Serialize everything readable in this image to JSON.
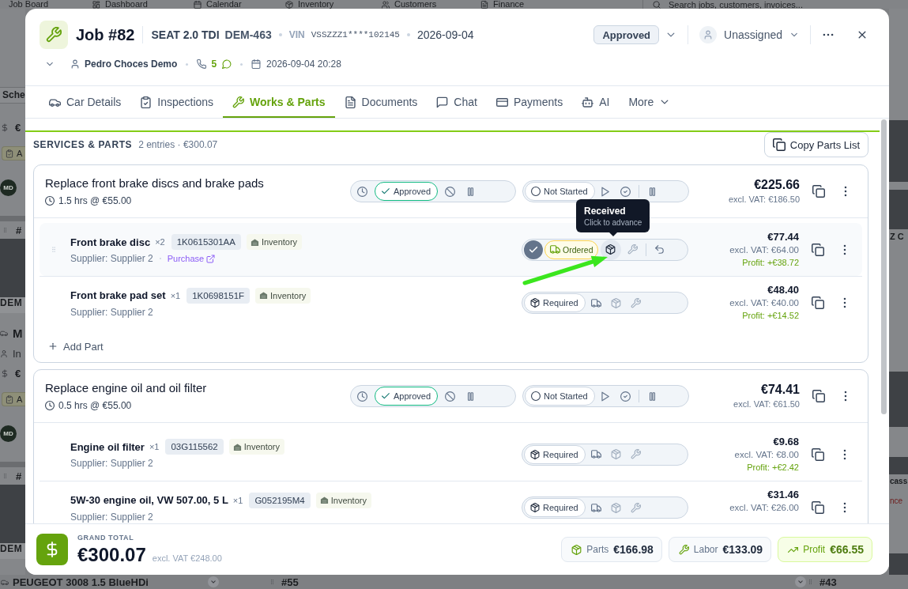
{
  "backdrop": {
    "nav": [
      "Job Board",
      "Dashboard",
      "Calendar",
      "Inventory",
      "Customers",
      "Finance"
    ],
    "search": {
      "placeholder": "Search jobs, customers, invoices..."
    },
    "left_strip": [
      {
        "kind": "heading",
        "text": "Sche"
      },
      {
        "kind": "price",
        "text": "€"
      },
      {
        "kind": "badge",
        "text": "A"
      },
      {
        "kind": "avatar",
        "text": "MD"
      },
      {
        "kind": "handle",
        "text": "#"
      },
      {
        "kind": "photo"
      },
      {
        "kind": "plate",
        "text": "DEM"
      },
      {
        "kind": "title",
        "text": "M"
      },
      {
        "kind": "person",
        "text": "In"
      },
      {
        "kind": "price",
        "text": "€"
      },
      {
        "kind": "badge",
        "text": "A"
      },
      {
        "kind": "avatar",
        "text": "MD"
      },
      {
        "kind": "handle",
        "text": "#"
      },
      {
        "kind": "photo"
      },
      {
        "kind": "plate",
        "text": "DEM"
      }
    ],
    "right_strip": [
      {
        "kind": "photo"
      },
      {
        "kind": "photo"
      },
      {
        "kind": "title",
        "text": "Z C"
      },
      {
        "kind": "photo"
      },
      {
        "kind": "photo"
      },
      {
        "kind": "title",
        "text": "cass"
      },
      {
        "kind": "alert",
        "text": "nce"
      },
      {
        "kind": "photo"
      }
    ],
    "bottom_strip": [
      {
        "kind": "title",
        "text": "PEUGEOT 3008 1.5 BlueHDi"
      },
      {
        "kind": "toggle"
      },
      {
        "kind": "handle",
        "text": "#55"
      },
      {
        "kind": "toggle"
      },
      {
        "kind": "handle",
        "text": "#43"
      }
    ]
  },
  "job": {
    "title": "Job #82",
    "vehicle": "SEAT 2.0 TDI",
    "plate": "DEM-463",
    "vin_label": "VIN",
    "vin": "VSSZZZ1****102145",
    "date": "2026-09-04",
    "status": "Approved",
    "assignee": "Unassigned",
    "customer": "Pedro Choces Demo",
    "phone_count": "5",
    "datetime": "2026-09-04 20:28"
  },
  "tabs": [
    {
      "kind": "tab",
      "label": "Car Details",
      "selected": false
    },
    {
      "kind": "tab",
      "label": "Inspections",
      "selected": false
    },
    {
      "kind": "tab",
      "label": "Works & Parts",
      "selected": true
    },
    {
      "kind": "tab",
      "label": "Documents",
      "selected": false
    },
    {
      "kind": "tab",
      "label": "Chat",
      "selected": false
    },
    {
      "kind": "tab",
      "label": "Payments",
      "selected": false
    },
    {
      "kind": "tab",
      "label": "AI",
      "selected": false
    },
    {
      "kind": "menu",
      "label": "More",
      "selected": false
    }
  ],
  "section": {
    "title": "SERVICES & PARTS",
    "summary": "2 entries · €300.07",
    "copy_button": "Copy Parts List"
  },
  "services": [
    {
      "title": "Replace front brake discs and brake pads",
      "labor": "1.5 hrs @ €55.00",
      "approval": {
        "kind": "approved",
        "label": "Approved"
      },
      "work": {
        "kind": "not_started",
        "label": "Not Started"
      },
      "price": "€225.66",
      "excl_vat": "excl. VAT: €186.50",
      "parts": [
        {
          "name": "Front brake disc",
          "qty": "×2",
          "part_number": "1K0615301AA",
          "source": "Inventory",
          "supplier": "Supplier: Supplier 2",
          "link": "Purchase",
          "hovered": true,
          "status": {
            "kind": "ordered",
            "label": "Ordered"
          },
          "tooltip": {
            "title": "Received",
            "hint": "Click to advance"
          },
          "price": "€77.44",
          "excl_vat": "excl. VAT: €64.00",
          "profit": "Profit: +€38.72"
        },
        {
          "name": "Front brake pad set",
          "qty": "×1",
          "part_number": "1K0698151F",
          "source": "Inventory",
          "supplier": "Supplier: Supplier 2",
          "hovered": false,
          "status": {
            "kind": "required",
            "label": "Required"
          },
          "price": "€48.40",
          "excl_vat": "excl. VAT: €40.00",
          "profit": "Profit: +€14.52"
        }
      ],
      "add_part": "Add Part"
    },
    {
      "title": "Replace engine oil and oil filter",
      "labor": "0.5 hrs @ €55.00",
      "approval": {
        "kind": "approved",
        "label": "Approved"
      },
      "work": {
        "kind": "not_started",
        "label": "Not Started"
      },
      "price": "€74.41",
      "excl_vat": "excl. VAT: €61.50",
      "parts": [
        {
          "name": "Engine oil filter",
          "qty": "×1",
          "part_number": "03G115562",
          "source": "Inventory",
          "supplier": "Supplier: Supplier 2",
          "hovered": false,
          "status": {
            "kind": "required",
            "label": "Required"
          },
          "price": "€9.68",
          "excl_vat": "excl. VAT: €8.00",
          "profit": "Profit: +€2.42"
        },
        {
          "name": "5W-30 engine oil, VW 507.00, 5 L",
          "qty": "×1",
          "part_number": "G052195M4",
          "source": "Inventory",
          "supplier": "Supplier: Supplier 2",
          "hovered": false,
          "status": {
            "kind": "required",
            "label": "Required"
          },
          "price": "€31.46",
          "excl_vat": "excl. VAT: €26.00"
        }
      ]
    }
  ],
  "footer": {
    "label": "GRAND TOTAL",
    "total": "€300.07",
    "excl_vat": "excl. VAT €248.00",
    "chips": [
      {
        "kind": "parts",
        "label": "Parts",
        "value": "€166.98"
      },
      {
        "kind": "labor",
        "label": "Labor",
        "value": "€133.09"
      },
      {
        "kind": "profit",
        "label": "Profit",
        "value": "€66.55"
      }
    ]
  }
}
